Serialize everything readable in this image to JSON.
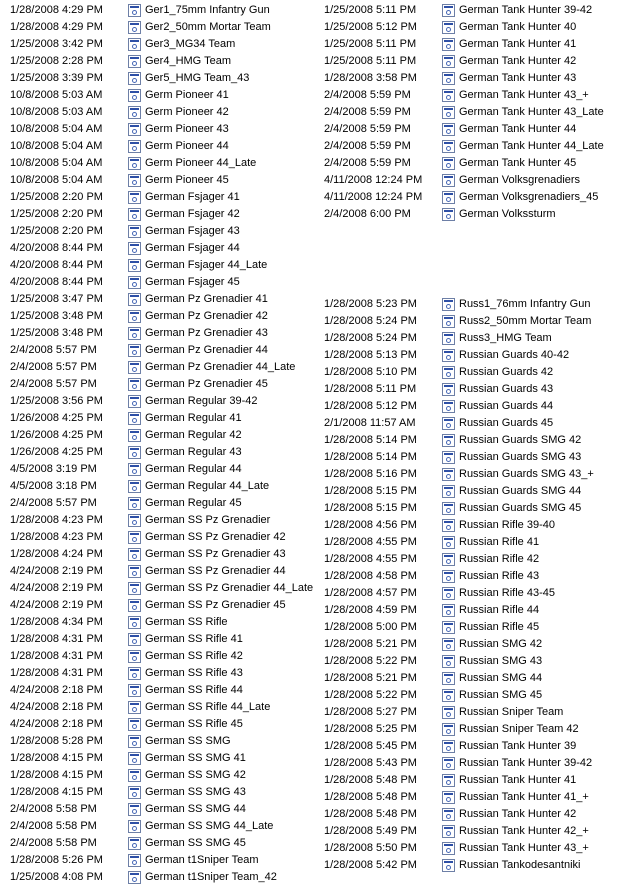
{
  "left_list": [
    {
      "date": "1/28/2008 4:29 PM",
      "name": "Ger1_75mm Infantry Gun"
    },
    {
      "date": "1/28/2008 4:29 PM",
      "name": "Ger2_50mm Mortar Team"
    },
    {
      "date": "1/25/2008 3:42 PM",
      "name": "Ger3_MG34 Team"
    },
    {
      "date": "1/25/2008 2:28 PM",
      "name": "Ger4_HMG Team"
    },
    {
      "date": "1/25/2008 3:39 PM",
      "name": "Ger5_HMG Team_43"
    },
    {
      "date": "10/8/2008 5:03 AM",
      "name": "Germ Pioneer 41"
    },
    {
      "date": "10/8/2008 5:03 AM",
      "name": "Germ Pioneer 42"
    },
    {
      "date": "10/8/2008 5:04 AM",
      "name": "Germ Pioneer 43"
    },
    {
      "date": "10/8/2008 5:04 AM",
      "name": "Germ Pioneer 44"
    },
    {
      "date": "10/8/2008 5:04 AM",
      "name": "Germ Pioneer 44_Late"
    },
    {
      "date": "10/8/2008 5:04 AM",
      "name": "Germ Pioneer 45"
    },
    {
      "date": "1/25/2008 2:20 PM",
      "name": "German Fsjager 41"
    },
    {
      "date": "1/25/2008 2:20 PM",
      "name": "German Fsjager 42"
    },
    {
      "date": "1/25/2008 2:20 PM",
      "name": "German Fsjager 43"
    },
    {
      "date": "4/20/2008 8:44 PM",
      "name": "German Fsjager 44"
    },
    {
      "date": "4/20/2008 8:44 PM",
      "name": "German Fsjager 44_Late"
    },
    {
      "date": "4/20/2008 8:44 PM",
      "name": "German Fsjager 45"
    },
    {
      "date": "1/25/2008 3:47 PM",
      "name": "German Pz Grenadier 41"
    },
    {
      "date": "1/25/2008 3:48 PM",
      "name": "German Pz Grenadier 42"
    },
    {
      "date": "1/25/2008 3:48 PM",
      "name": "German Pz Grenadier 43"
    },
    {
      "date": "2/4/2008 5:57 PM",
      "name": "German Pz Grenadier 44"
    },
    {
      "date": "2/4/2008 5:57 PM",
      "name": "German Pz Grenadier 44_Late"
    },
    {
      "date": "2/4/2008 5:57 PM",
      "name": "German Pz Grenadier 45"
    },
    {
      "date": "1/25/2008 3:56 PM",
      "name": "German Regular 39-42"
    },
    {
      "date": "1/26/2008 4:25 PM",
      "name": "German Regular 41"
    },
    {
      "date": "1/26/2008 4:25 PM",
      "name": "German Regular 42"
    },
    {
      "date": "1/26/2008 4:25 PM",
      "name": "German Regular 43"
    },
    {
      "date": "4/5/2008 3:19 PM",
      "name": "German Regular 44"
    },
    {
      "date": "4/5/2008 3:18 PM",
      "name": "German Regular 44_Late"
    },
    {
      "date": "2/4/2008 5:57 PM",
      "name": "German Regular 45"
    },
    {
      "date": "1/28/2008 4:23 PM",
      "name": "German SS Pz Grenadier"
    },
    {
      "date": "1/28/2008 4:23 PM",
      "name": "German SS Pz Grenadier 42"
    },
    {
      "date": "1/28/2008 4:24 PM",
      "name": "German SS Pz Grenadier 43"
    },
    {
      "date": "4/24/2008 2:19 PM",
      "name": "German SS Pz Grenadier 44"
    },
    {
      "date": "4/24/2008 2:19 PM",
      "name": "German SS Pz Grenadier 44_Late"
    },
    {
      "date": "4/24/2008 2:19 PM",
      "name": "German SS Pz Grenadier 45"
    },
    {
      "date": "1/28/2008 4:34 PM",
      "name": "German SS Rifle"
    },
    {
      "date": "1/28/2008 4:31 PM",
      "name": "German SS Rifle 41"
    },
    {
      "date": "1/28/2008 4:31 PM",
      "name": "German SS Rifle 42"
    },
    {
      "date": "1/28/2008 4:31 PM",
      "name": "German SS Rifle 43"
    },
    {
      "date": "4/24/2008 2:18 PM",
      "name": "German SS Rifle 44"
    },
    {
      "date": "4/24/2008 2:18 PM",
      "name": "German SS Rifle 44_Late"
    },
    {
      "date": "4/24/2008 2:18 PM",
      "name": "German SS Rifle 45"
    },
    {
      "date": "1/28/2008 5:28 PM",
      "name": "German SS SMG"
    },
    {
      "date": "1/28/2008 4:15 PM",
      "name": "German SS SMG 41"
    },
    {
      "date": "1/28/2008 4:15 PM",
      "name": "German SS SMG 42"
    },
    {
      "date": "1/28/2008 4:15 PM",
      "name": "German SS SMG 43"
    },
    {
      "date": "2/4/2008 5:58 PM",
      "name": "German SS SMG 44"
    },
    {
      "date": "2/4/2008 5:58 PM",
      "name": "German SS SMG 44_Late"
    },
    {
      "date": "2/4/2008 5:58 PM",
      "name": "German SS SMG 45"
    },
    {
      "date": "1/28/2008 5:26 PM",
      "name": "German t1Sniper Team"
    },
    {
      "date": "1/25/2008 4:08 PM",
      "name": "German t1Sniper Team_42"
    }
  ],
  "right_top_list": [
    {
      "date": "1/25/2008 5:11 PM",
      "name": "German Tank Hunter 39-42"
    },
    {
      "date": "1/25/2008 5:12 PM",
      "name": "German Tank Hunter 40"
    },
    {
      "date": "1/25/2008 5:11 PM",
      "name": "German Tank Hunter 41"
    },
    {
      "date": "1/25/2008 5:11 PM",
      "name": "German Tank Hunter 42"
    },
    {
      "date": "1/28/2008 3:58 PM",
      "name": "German Tank Hunter 43"
    },
    {
      "date": "2/4/2008 5:59 PM",
      "name": "German Tank Hunter 43_+"
    },
    {
      "date": "2/4/2008 5:59 PM",
      "name": "German Tank Hunter 43_Late"
    },
    {
      "date": "2/4/2008 5:59 PM",
      "name": "German Tank Hunter 44"
    },
    {
      "date": "2/4/2008 5:59 PM",
      "name": "German Tank Hunter 44_Late"
    },
    {
      "date": "2/4/2008 5:59 PM",
      "name": "German Tank Hunter 45"
    },
    {
      "date": "4/11/2008 12:24 PM",
      "name": "German Volksgrenadiers"
    },
    {
      "date": "4/11/2008 12:24 PM",
      "name": "German Volksgrenadiers_45"
    },
    {
      "date": "2/4/2008 6:00 PM",
      "name": "German Volkssturm"
    }
  ],
  "right_bottom_list": [
    {
      "date": "1/28/2008 5:23 PM",
      "name": "Russ1_76mm Infantry Gun"
    },
    {
      "date": "1/28/2008 5:24 PM",
      "name": "Russ2_50mm Mortar Team"
    },
    {
      "date": "1/28/2008 5:24 PM",
      "name": "Russ3_HMG Team"
    },
    {
      "date": "1/28/2008 5:13 PM",
      "name": "Russian Guards 40-42"
    },
    {
      "date": "1/28/2008 5:10 PM",
      "name": "Russian Guards 42"
    },
    {
      "date": "1/28/2008 5:11 PM",
      "name": "Russian Guards 43"
    },
    {
      "date": "1/28/2008 5:12 PM",
      "name": "Russian Guards 44"
    },
    {
      "date": "2/1/2008 11:57 AM",
      "name": "Russian Guards 45"
    },
    {
      "date": "1/28/2008 5:14 PM",
      "name": "Russian Guards SMG 42"
    },
    {
      "date": "1/28/2008 5:14 PM",
      "name": "Russian Guards SMG 43"
    },
    {
      "date": "1/28/2008 5:16 PM",
      "name": "Russian Guards SMG 43_+"
    },
    {
      "date": "1/28/2008 5:15 PM",
      "name": "Russian Guards SMG 44"
    },
    {
      "date": "1/28/2008 5:15 PM",
      "name": "Russian Guards SMG 45"
    },
    {
      "date": "1/28/2008 4:56 PM",
      "name": "Russian Rifle 39-40"
    },
    {
      "date": "1/28/2008 4:55 PM",
      "name": "Russian Rifle 41"
    },
    {
      "date": "1/28/2008 4:55 PM",
      "name": "Russian Rifle 42"
    },
    {
      "date": "1/28/2008 4:58 PM",
      "name": "Russian Rifle 43"
    },
    {
      "date": "1/28/2008 4:57 PM",
      "name": "Russian Rifle 43-45"
    },
    {
      "date": "1/28/2008 4:59 PM",
      "name": "Russian Rifle 44"
    },
    {
      "date": "1/28/2008 5:00 PM",
      "name": "Russian Rifle 45"
    },
    {
      "date": "1/28/2008 5:21 PM",
      "name": "Russian SMG 42"
    },
    {
      "date": "1/28/2008 5:22 PM",
      "name": "Russian SMG 43"
    },
    {
      "date": "1/28/2008 5:21 PM",
      "name": "Russian SMG 44"
    },
    {
      "date": "1/28/2008 5:22 PM",
      "name": "Russian SMG 45"
    },
    {
      "date": "1/28/2008 5:27 PM",
      "name": "Russian Sniper Team"
    },
    {
      "date": "1/28/2008 5:25 PM",
      "name": "Russian Sniper Team 42"
    },
    {
      "date": "1/28/2008 5:45 PM",
      "name": "Russian Tank Hunter 39"
    },
    {
      "date": "1/28/2008 5:43 PM",
      "name": "Russian Tank Hunter 39-42"
    },
    {
      "date": "1/28/2008 5:48 PM",
      "name": "Russian Tank Hunter 41"
    },
    {
      "date": "1/28/2008 5:48 PM",
      "name": "Russian Tank Hunter 41_+"
    },
    {
      "date": "1/28/2008 5:48 PM",
      "name": "Russian Tank Hunter 42"
    },
    {
      "date": "1/28/2008 5:49 PM",
      "name": "Russian Tank Hunter 42_+"
    },
    {
      "date": "1/28/2008 5:50 PM",
      "name": "Russian Tank Hunter 43_+"
    },
    {
      "date": "1/28/2008 5:42 PM",
      "name": "Russian Tankodesantniki"
    }
  ],
  "icon_name": "file-document-icon"
}
